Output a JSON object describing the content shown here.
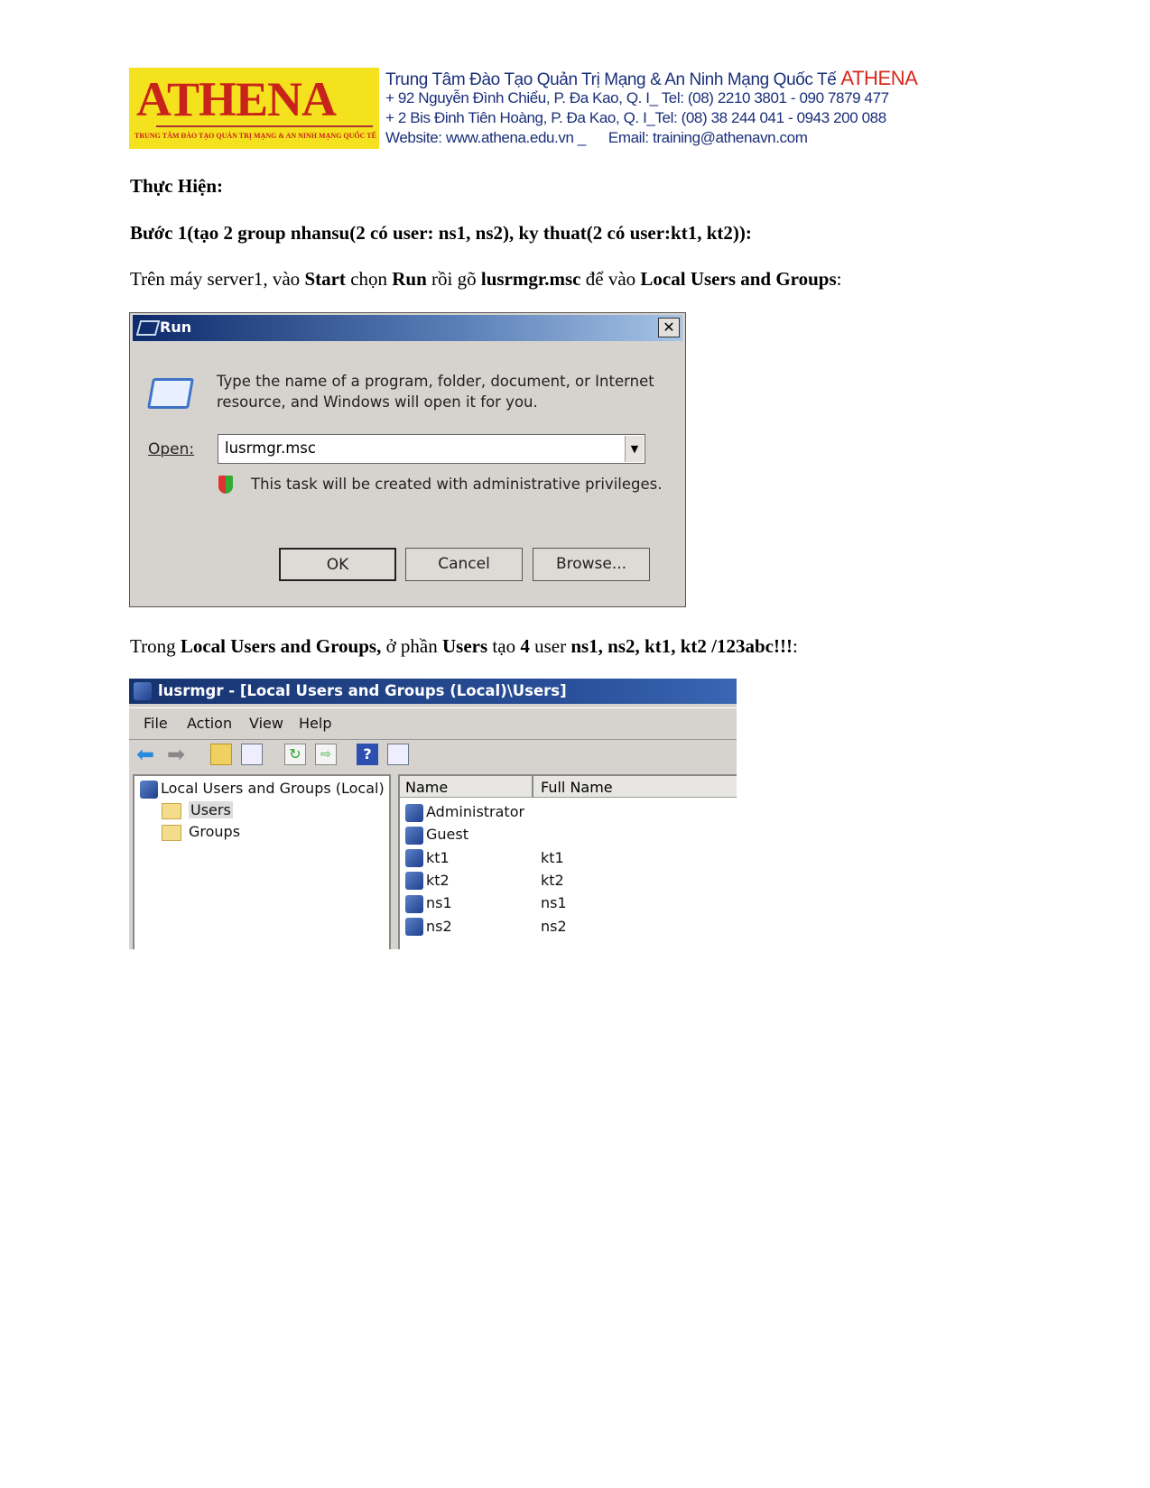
{
  "header": {
    "logo_text": "ATHENA",
    "logo_subtitle": "TRUNG TÂM ĐÀO TẠO QUẢN TRỊ MẠNG & AN NINH MẠNG QUỐC TẾ",
    "org_name": "Trung Tâm Đào Tạo Quản Trị Mạng & An Ninh Mạng Quốc Tế",
    "org_brand": "ATHENA",
    "address1": "+ 92 Nguyễn Đình Chiểu, P. Đa Kao, Q. I_ Tel: (08) 2210 3801 -  090 7879 477",
    "address2": "+ 2 Bis Đinh Tiên Hoàng, P. Đa Kao, Q. I_Tel: (08) 38 244 041 - 0943 200 088",
    "website": "Website:  www.athena.edu.vn     _",
    "email": "Email: training@athenavn.com"
  },
  "doc": {
    "heading": "Thực Hiện:",
    "step1": "Bước 1(tạo 2 group nhansu(2 có user: ns1, ns2), ky thuat(2 có user:kt1, kt2)):",
    "p1": [
      {
        "t": "Trên máy server1, vào ",
        "b": false
      },
      {
        "t": "Start",
        "b": true
      },
      {
        "t": " chọn ",
        "b": false
      },
      {
        "t": "Run",
        "b": true
      },
      {
        "t": " rồi gõ ",
        "b": false
      },
      {
        "t": "lusrmgr.msc",
        "b": true
      },
      {
        "t": " để vào ",
        "b": false
      },
      {
        "t": "Local Users and Groups",
        "b": true
      },
      {
        "t": ":",
        "b": false
      }
    ],
    "p2": [
      {
        "t": "Trong ",
        "b": false
      },
      {
        "t": "Local Users and Groups,",
        "b": true
      },
      {
        "t": " ở phần ",
        "b": false
      },
      {
        "t": "Users",
        "b": true
      },
      {
        "t": " tạo ",
        "b": false
      },
      {
        "t": "4",
        "b": true
      },
      {
        "t": " user ",
        "b": false
      },
      {
        "t": "ns1, ns2, kt1, kt2 /123abc!!!",
        "b": true
      },
      {
        "t": ":",
        "b": false
      }
    ]
  },
  "run_dialog": {
    "title": "Run",
    "description_line1": "Type the name of a program, folder, document, or Internet",
    "description_line2": "resource, and Windows will open it for you.",
    "open_label": "Open:",
    "open_value": "lusrmgr.msc",
    "admin_note": "This task will be created with administrative privileges.",
    "ok": "OK",
    "cancel": "Cancel",
    "browse": "Browse..."
  },
  "mmc": {
    "title": "lusrmgr - [Local Users and Groups (Local)\\Users]",
    "menu": [
      "File",
      "Action",
      "View",
      "Help"
    ],
    "tree_root": "Local Users and Groups (Local)",
    "tree_items": [
      "Users",
      "Groups"
    ],
    "selected_tree_item": "Users",
    "columns": [
      "Name",
      "Full Name"
    ],
    "users": [
      {
        "name": "Administrator",
        "full_name": ""
      },
      {
        "name": "Guest",
        "full_name": ""
      },
      {
        "name": "kt1",
        "full_name": "kt1"
      },
      {
        "name": "kt2",
        "full_name": "kt2"
      },
      {
        "name": "ns1",
        "full_name": "ns1"
      },
      {
        "name": "ns2",
        "full_name": "ns2"
      }
    ]
  }
}
